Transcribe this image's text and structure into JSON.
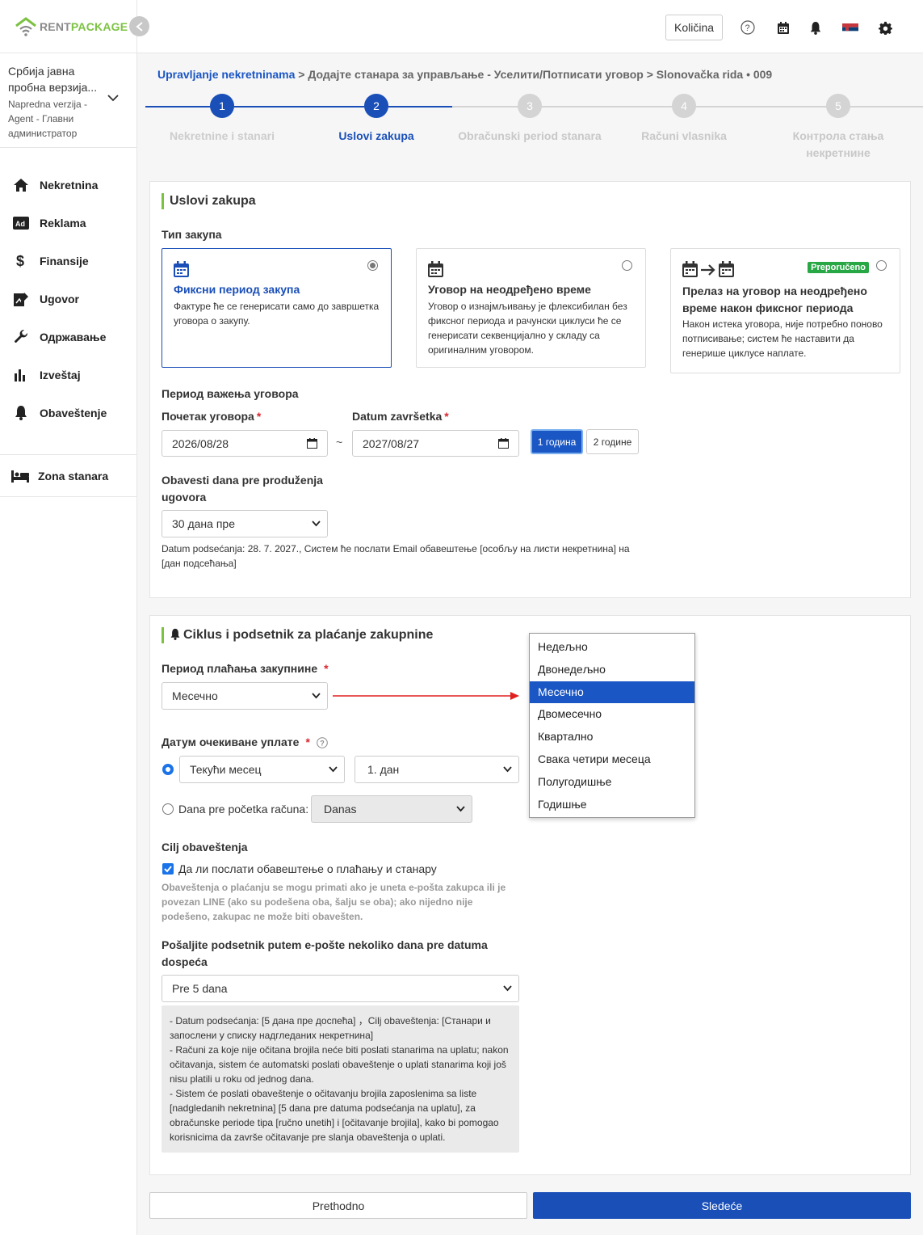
{
  "brand": {
    "rent": "RENT",
    "package": "PACKAGE"
  },
  "account": {
    "name": "Србија јавна пробна верзија...",
    "sub": "Napredna verzija - Agent - Главни администратор"
  },
  "nav": [
    {
      "label": "Nekretnina",
      "icon": "home-icon"
    },
    {
      "label": "Reklama",
      "icon": "ad-icon"
    },
    {
      "label": "Finansije",
      "icon": "dollar-icon"
    },
    {
      "label": "Ugovor",
      "icon": "contract-icon"
    },
    {
      "label": "Одржавање",
      "icon": "wrench-icon"
    },
    {
      "label": "Izveštaj",
      "icon": "bar-chart-icon"
    },
    {
      "label": "Obaveštenje",
      "icon": "bell-icon"
    }
  ],
  "zone": {
    "label": "Zona stanara",
    "icon": "bed-icon"
  },
  "topbar": {
    "qty_label": "Količina"
  },
  "breadcrumb": {
    "root": "Upravljanje nekretninama",
    "sep": ">",
    "step": "Додајте станара за управљање - Уселити/Потписати уговор",
    "property": "Slonovačka rida • 009"
  },
  "steps": [
    {
      "num": "1",
      "label": "Nekretnine i stanari",
      "state": "done"
    },
    {
      "num": "2",
      "label": "Uslovi zakupa",
      "state": "active"
    },
    {
      "num": "3",
      "label": "Obračunski period stanara",
      "state": "todo"
    },
    {
      "num": "4",
      "label": "Računi vlasnika",
      "state": "todo"
    },
    {
      "num": "5",
      "label": "Контрола стања некретнине",
      "state": "todo"
    }
  ],
  "lease": {
    "title": "Uslovi zakupa",
    "type_label": "Тип закупа",
    "options": [
      {
        "title": "Фиксни период закупа",
        "desc": "Фактуре ће се генерисати само до завршетка уговора о закупу.",
        "selected": true
      },
      {
        "title": "Уговор на неодређено време",
        "desc": "Уговор о изнајмљивању је флексибилан без фиксног периода и рачунски циклуси ће се генерисати секвенцијално у складу са оригиналним уговором.",
        "selected": false
      },
      {
        "title": "Прелаз на уговор на неодређено време након фиксног периода",
        "desc": "Након истека уговора, није потребно поново потписивање; систем ће наставити да генерише циклусе наплате.",
        "selected": false,
        "badge": "Preporučeno"
      }
    ],
    "period_label": "Период важења уговора",
    "start_label": "Почетак уговора",
    "end_label": "Datum završetka",
    "start_value": "2026/08/28",
    "end_value": "2027/08/27",
    "tilde": "~",
    "btn_1y": "1 година",
    "btn_2y": "2 године",
    "notify_label": "Obavesti dana pre produženja ugovora",
    "notify_value": "30 дана пре",
    "notify_hint": "Datum podsećanja: 28. 7. 2027., Систем ће послати Email обавештење [особљу на листи некретнина] на [дан подсећања]"
  },
  "payment": {
    "title": "Ciklus i podsetnik za plaćanje zakupnine",
    "period_label": "Период плаћања закупнине",
    "period_value": "Месечно",
    "period_options": [
      "Недељно",
      "Двонедељно",
      "Месечно",
      "Двомесечно",
      "Квартално",
      "Свака четири месеца",
      "Полугодишње",
      "Годишње"
    ],
    "period_selected_index": 2,
    "due_label": "Датум очекиване уплате",
    "due_month": "Текући месец",
    "due_day": "1. дан",
    "days_before_label": "Dana pre početka računa:",
    "days_before_value": "Danas",
    "target_label": "Cilj obaveštenja",
    "target_check": "Да ли послати обавештење о плаћању и станару",
    "target_note": "Obaveštenja o plaćanju se mogu primati ako je uneta e-pošta zakupca ili je povezan LINE (ako su podešena oba, šalju se oba); ako nijedno nije podešeno, zakupac ne može biti obavešten.",
    "email_label": "Pošaljite podsetnik putem e-pošte nekoliko dana pre datuma dospeća",
    "email_value": "Pre 5 dana",
    "info": [
      "- Datum podsećanja: [5 дана пре доспећа] ，Cilj obaveštenja: [Станари и запослени у списку надгледаних некретнина]",
      "- Računi za koje nije očitana brojila neće biti poslati stanarima na uplatu; nakon očitavanja, sistem će automatski poslati obaveštenje o uplati stanarima koji još nisu platili u roku od jednog dana.",
      "- Sistem će poslati obaveštenje o očitavanju brojila zaposlenima sa liste [nadgledanih nekretnina] [5 dana pre datuma podsećanja na uplatu], za obračunske periode tipa [ručno unetih] i [očitavanje brojila], kako bi pomogao korisnicima da završe očitavanje pre slanja obaveštenja o uplati."
    ]
  },
  "footer": {
    "prev": "Prethodno",
    "next": "Sledeće"
  },
  "colors": {
    "primary": "#1a4fb8",
    "brand_green": "#7cc242",
    "badge_green": "#28a745",
    "required": "#d9262d"
  }
}
